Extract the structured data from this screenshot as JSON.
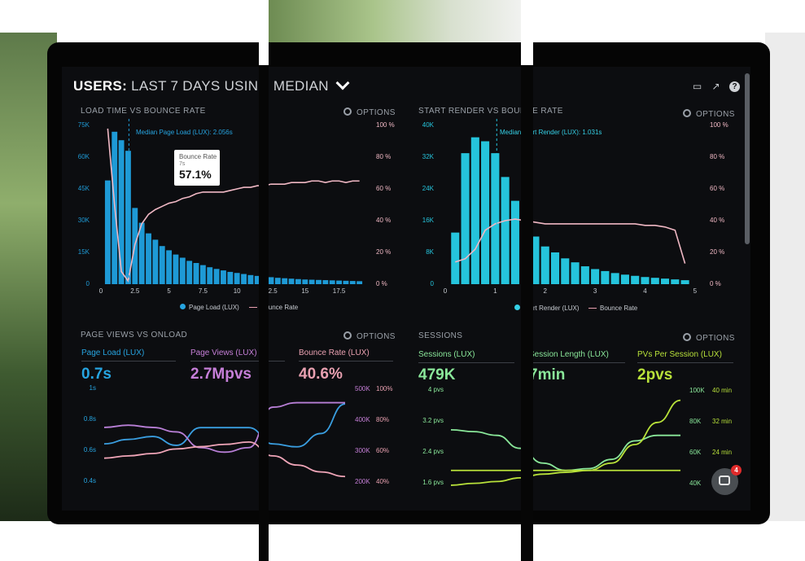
{
  "dashboard": {
    "title_bold": "USERS:",
    "title_rest_a": "LAST 7 DAYS",
    "title_rest_b": "USING MEDIAN",
    "title_dim": "",
    "options_label": "OPTIONS"
  },
  "top_icons": [
    "monitor-icon",
    "share-icon",
    "help-icon"
  ],
  "colors": {
    "blue": "#26a4e0",
    "pink": "#e8a0b0",
    "cyan": "#35d0e6",
    "green": "#8ae89a",
    "lime": "#b8e13a",
    "purple": "#c67fd8"
  },
  "panels": {
    "load_time": {
      "title": "LOAD TIME VS BOUNCE RATE",
      "median_label": "Median Page Load (LUX): 2.056s",
      "left_ticks": [
        "75K",
        "60K",
        "45K",
        "30K",
        "15K",
        "0"
      ],
      "right_ticks": [
        "100 %",
        "80 %",
        "60 %",
        "40 %",
        "20 %",
        "0 %"
      ],
      "x_ticks": [
        "0",
        "2.5",
        "5",
        "7.5",
        "10",
        "12.5",
        "15",
        "17.5"
      ],
      "legend_a": "Page Load (LUX)",
      "legend_b": "Bounce Rate",
      "tooltip_title": "Bounce Rate",
      "tooltip_sub": "7s",
      "tooltip_value": "57.1%"
    },
    "start_render": {
      "title": "START RENDER VS BOUNCE RATE",
      "median_label": "Median Start Render (LUX): 1.031s",
      "left_ticks": [
        "40K",
        "32K",
        "24K",
        "16K",
        "8K",
        "0"
      ],
      "right_ticks": [
        "100 %",
        "80 %",
        "60 %",
        "40 %",
        "20 %",
        "0 %"
      ],
      "x_ticks": [
        "0",
        "1",
        "2",
        "3",
        "4",
        "5"
      ],
      "legend_a": "Start Render (LUX)",
      "legend_b": "Bounce Rate"
    },
    "page_views": {
      "title": "PAGE VIEWS VS ONLOAD",
      "metrics": [
        {
          "label": "Page Load (LUX)",
          "value": "0.7s"
        },
        {
          "label": "Page Views (LUX)",
          "value": "2.7Mpvs"
        },
        {
          "label": "Bounce Rate (LUX)",
          "value": "40.6%"
        }
      ],
      "left_ticks": [
        "1s",
        "0.8s",
        "0.6s",
        "0.4s"
      ],
      "mid_ticks": [
        "500K",
        "400K",
        "300K",
        "200K"
      ],
      "right_ticks": [
        "100%",
        "80%",
        "60%",
        "40%"
      ]
    },
    "sessions": {
      "title": "SESSIONS",
      "metrics": [
        {
          "label": "Sessions (LUX)",
          "value": "479K"
        },
        {
          "label": "Session Length (LUX)",
          "value": "7min"
        },
        {
          "label": "PVs Per Session (LUX)",
          "value": "2pvs"
        }
      ],
      "left_ticks": [
        "4 pvs",
        "3.2 pvs",
        "2.4 pvs",
        "1.6 pvs"
      ],
      "right_ticks_a": [
        "100K",
        "80K",
        "60K",
        "40K"
      ],
      "right_ticks_b": [
        "40 min",
        "32 min",
        "24 min",
        ""
      ]
    }
  },
  "chart_data": [
    {
      "type": "bar",
      "title": "LOAD TIME VS BOUNCE RATE",
      "x": [
        0.5,
        1,
        1.5,
        2,
        2.5,
        3,
        3.5,
        4,
        4.5,
        5,
        5.5,
        6,
        6.5,
        7,
        7.5,
        8,
        8.5,
        9,
        9.5,
        10,
        10.5,
        11,
        11.5,
        12,
        12.5,
        13,
        13.5,
        14,
        14.5,
        15,
        15.5,
        16,
        16.5,
        17,
        17.5,
        18,
        18.5,
        19
      ],
      "series": [
        {
          "name": "Page Load (LUX)",
          "values": [
            49000,
            72000,
            68000,
            63000,
            36000,
            29000,
            24000,
            21000,
            18000,
            16000,
            14000,
            12500,
            11000,
            10000,
            9000,
            8000,
            7200,
            6500,
            5800,
            5300,
            4800,
            4300,
            3900,
            3500,
            3300,
            3000,
            2800,
            2600,
            2400,
            2200,
            2100,
            2000,
            1900,
            1800,
            1700,
            1600,
            1500,
            1400
          ]
        },
        {
          "name": "Bounce Rate",
          "values": [
            98,
            50,
            8,
            2,
            25,
            38,
            44,
            47,
            49,
            51,
            52,
            54,
            55,
            57,
            58,
            58,
            58,
            58,
            59,
            60,
            61,
            61,
            62,
            62,
            63,
            63,
            63,
            64,
            64,
            64,
            65,
            65,
            64,
            65,
            65,
            64,
            65,
            65
          ]
        }
      ],
      "ylim": [
        0,
        75000
      ],
      "y2lim": [
        0,
        100
      ],
      "xlim": [
        0,
        19.5
      ],
      "median": 2.056
    },
    {
      "type": "bar",
      "title": "START RENDER VS BOUNCE RATE",
      "x": [
        0.2,
        0.4,
        0.6,
        0.8,
        1,
        1.2,
        1.4,
        1.6,
        1.8,
        2,
        2.2,
        2.4,
        2.6,
        2.8,
        3,
        3.2,
        3.4,
        3.6,
        3.8,
        4,
        4.2,
        4.4,
        4.6,
        4.8
      ],
      "series": [
        {
          "name": "Start Render (LUX)",
          "values": [
            13000,
            33000,
            37000,
            36000,
            33000,
            27000,
            21000,
            16000,
            12000,
            9500,
            8000,
            6500,
            5500,
            4500,
            3800,
            3300,
            2800,
            2400,
            2100,
            1800,
            1600,
            1400,
            1200,
            1000
          ]
        },
        {
          "name": "Bounce Rate",
          "values": [
            14,
            16,
            22,
            34,
            38,
            40,
            41,
            40,
            39,
            38,
            38,
            38,
            38,
            38,
            38,
            38,
            38,
            38,
            38,
            37,
            37,
            36,
            34,
            13
          ]
        }
      ],
      "ylim": [
        0,
        40000
      ],
      "y2lim": [
        0,
        100
      ],
      "xlim": [
        0,
        5.1
      ],
      "median": 1.031
    },
    {
      "type": "line",
      "title": "PAGE VIEWS VS ONLOAD",
      "x": [
        0,
        1,
        2,
        3,
        4,
        5,
        6,
        7,
        8,
        9,
        10
      ],
      "series": [
        {
          "name": "Page Load (LUX)",
          "values": [
            0.63,
            0.66,
            0.68,
            0.62,
            0.74,
            0.74,
            0.74,
            0.63,
            0.61,
            0.7,
            0.9
          ]
        },
        {
          "name": "Page Views (LUX)",
          "values": [
            390,
            400,
            390,
            370,
            300,
            280,
            300,
            480,
            500,
            500,
            500
          ]
        },
        {
          "name": "Bounce Rate (LUX)",
          "values": [
            0.45,
            0.46,
            0.47,
            0.49,
            0.5,
            0.51,
            0.52,
            0.46,
            0.42,
            0.39,
            0.37
          ]
        }
      ],
      "ylim": [
        0.3,
        1
      ]
    },
    {
      "type": "line",
      "title": "SESSIONS",
      "x": [
        0,
        1,
        2,
        3,
        4,
        5,
        6,
        7,
        8,
        9,
        10
      ],
      "series": [
        {
          "name": "Sessions (LUX)",
          "values": [
            3.1,
            3.05,
            2.95,
            2.6,
            2.2,
            2.0,
            2.05,
            2.3,
            2.8,
            2.95,
            2.95
          ]
        },
        {
          "name": "Session Length (LUX)",
          "values": [
            2.0,
            2.0,
            2.0,
            2.0,
            2.0,
            2.0,
            2.0,
            2.0,
            2.0,
            2.0,
            2.0
          ]
        },
        {
          "name": "PVs Per Session (LUX)",
          "values": [
            1.6,
            1.65,
            1.7,
            1.8,
            1.9,
            1.95,
            2.0,
            2.2,
            2.7,
            3.3,
            3.9
          ]
        }
      ],
      "ylim": [
        1.4,
        4.2
      ]
    }
  ],
  "chat": {
    "badge_count": "4"
  }
}
